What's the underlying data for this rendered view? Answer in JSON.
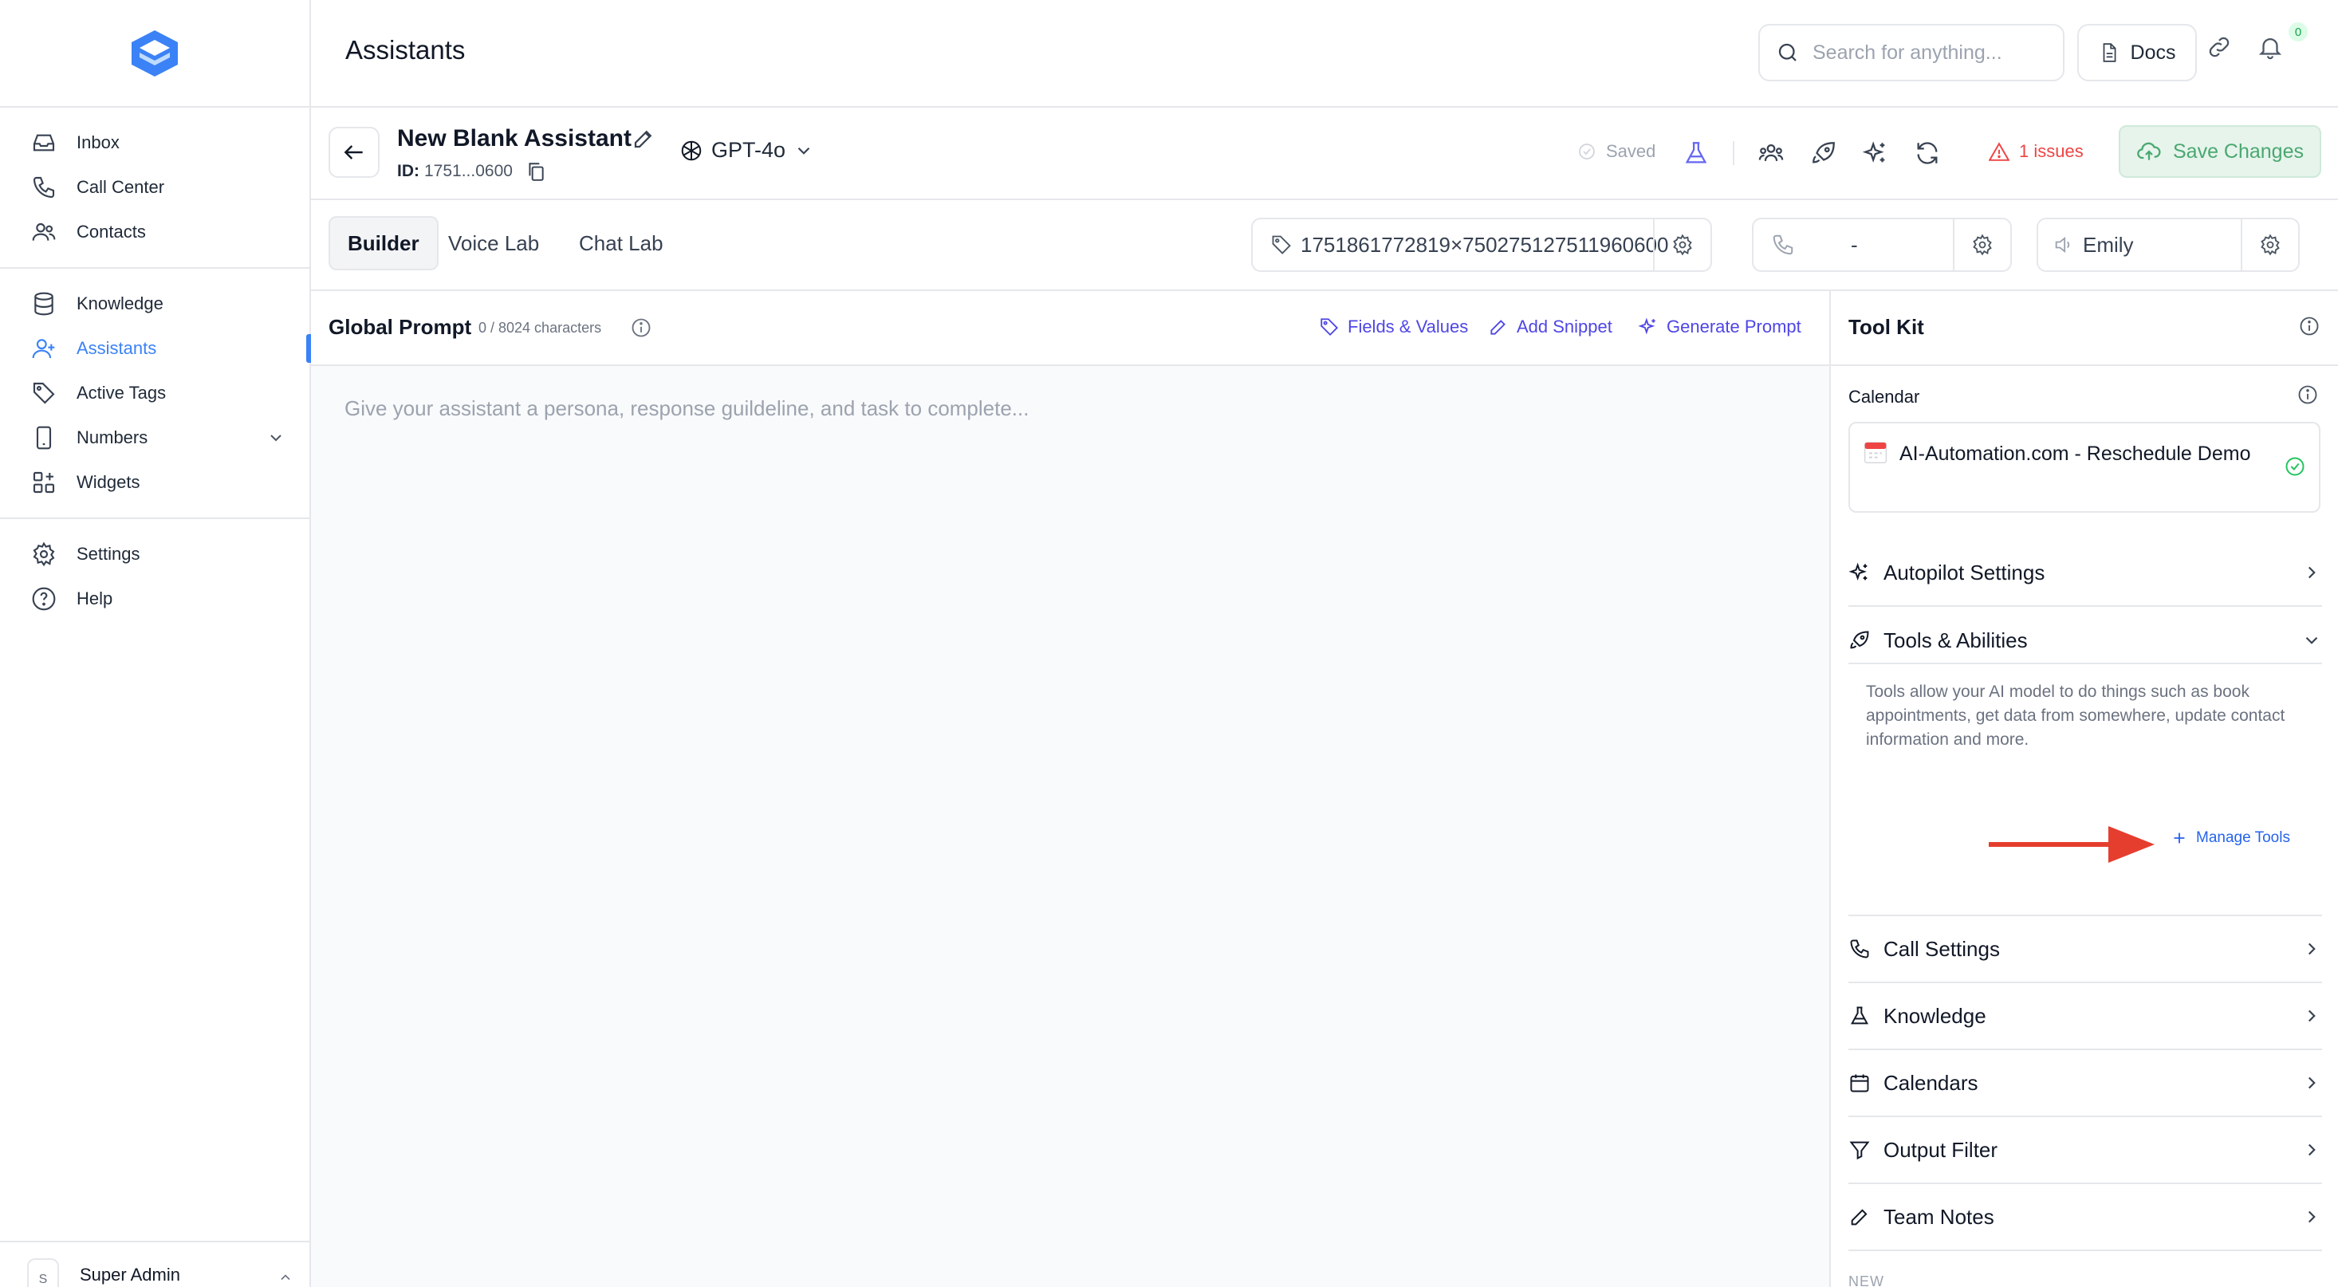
{
  "app": {
    "page_title": "Assistants",
    "brand_color": "#3b82f6"
  },
  "sidebar": {
    "groups": [
      [
        {
          "label": "Inbox",
          "icon": "inbox-icon"
        },
        {
          "label": "Call Center",
          "icon": "phone-icon"
        },
        {
          "label": "Contacts",
          "icon": "users-icon"
        }
      ],
      [
        {
          "label": "Knowledge",
          "icon": "database-icon"
        },
        {
          "label": "Assistants",
          "icon": "user-plus-icon",
          "active": true
        },
        {
          "label": "Active Tags",
          "icon": "tag-icon"
        },
        {
          "label": "Numbers",
          "icon": "mobile-icon",
          "expandable": true
        },
        {
          "label": "Widgets",
          "icon": "widgets-icon"
        }
      ],
      [
        {
          "label": "Settings",
          "icon": "gear-icon"
        },
        {
          "label": "Help",
          "icon": "help-icon"
        }
      ]
    ],
    "user": {
      "name": "Super Admin",
      "initial": "S"
    }
  },
  "topbar": {
    "search_placeholder": "Search for anything...",
    "docs_label": "Docs",
    "notification_count": "0"
  },
  "assistant": {
    "name": "New Blank Assistant",
    "id_label": "ID:",
    "id_value": "1751...0600",
    "model": "GPT-4o",
    "saved_label": "Saved",
    "issues_label": "1 issues",
    "save_button": "Save Changes"
  },
  "tabs": [
    {
      "label": "Builder",
      "active": true
    },
    {
      "label": "Voice Lab"
    },
    {
      "label": "Chat Lab"
    }
  ],
  "controls": {
    "tag_value": "1751861772819×750275127511960600",
    "phone_value": "-",
    "voice_value": "Emily"
  },
  "prompt": {
    "title": "Global Prompt",
    "char_count": "0 / 8024 characters",
    "fields_values": "Fields & Values",
    "add_snippet": "Add Snippet",
    "generate_prompt": "Generate Prompt",
    "placeholder": "Give your assistant a persona, response guildeline, and task to complete..."
  },
  "toolkit": {
    "title": "Tool Kit",
    "calendar_label": "Calendar",
    "calendar_name": "AI-Automation.com - Reschedule Demo",
    "sections": [
      {
        "label": "Autopilot Settings",
        "icon": "sparkles-icon",
        "expanded": false
      },
      {
        "label": "Tools & Abilities",
        "icon": "rocket-icon",
        "expanded": true
      }
    ],
    "tools_description": "Tools allow your AI model to do things such as book appointments, get data from somewhere, update contact information and more.",
    "manage_tools": "Manage Tools",
    "more_sections": [
      {
        "label": "Call Settings",
        "icon": "phone-icon"
      },
      {
        "label": "Knowledge",
        "icon": "flask-icon"
      },
      {
        "label": "Calendars",
        "icon": "calendar-icon"
      },
      {
        "label": "Output Filter",
        "icon": "filter-icon"
      },
      {
        "label": "Team Notes",
        "icon": "pencil-icon"
      }
    ],
    "new_label": "NEW"
  }
}
